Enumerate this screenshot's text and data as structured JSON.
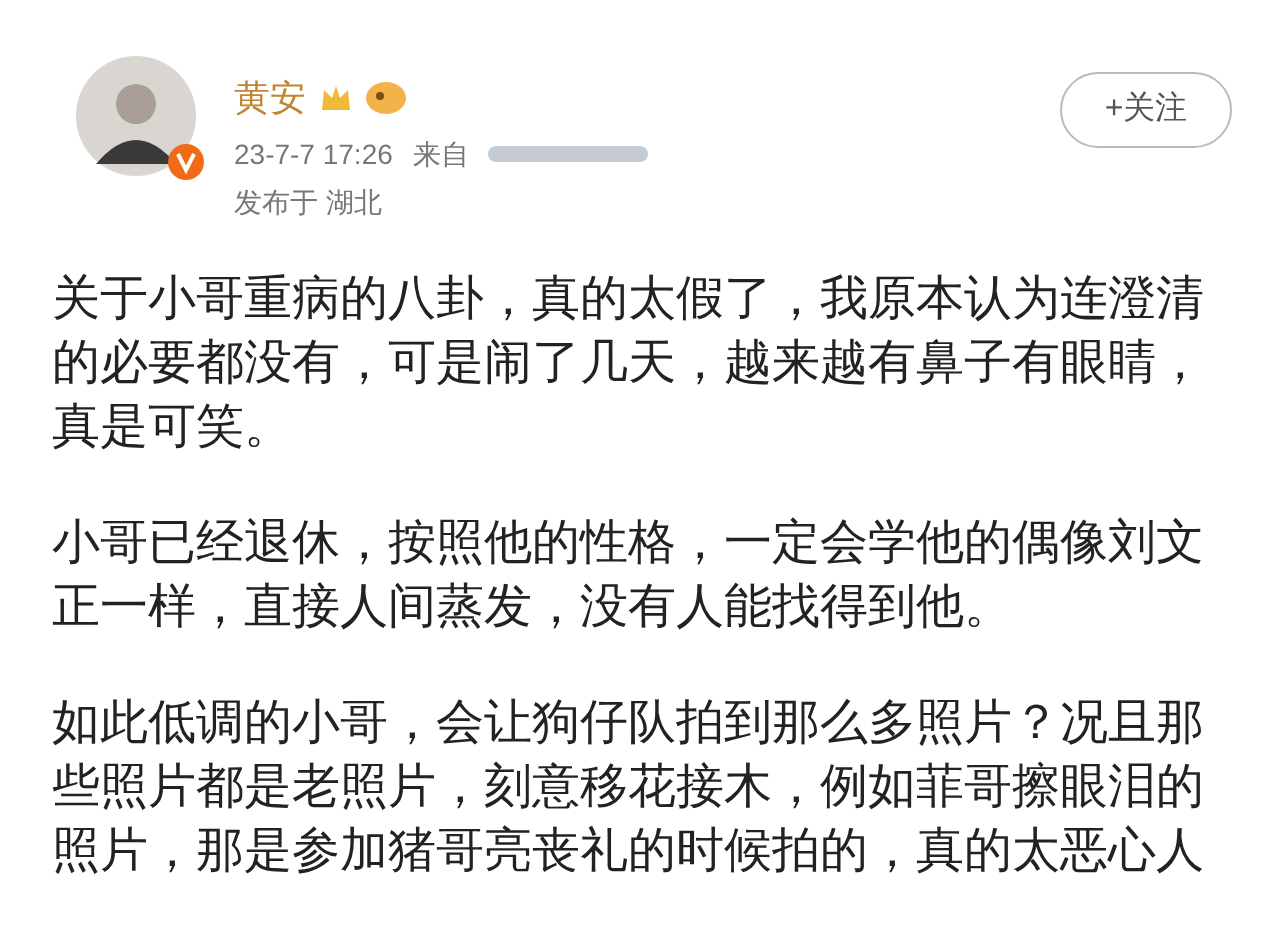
{
  "post": {
    "author": "黄安",
    "timestamp": "23-7-7 17:26",
    "source_label": "来自",
    "location": "发布于 湖北",
    "follow_button": "+关注",
    "paragraphs": [
      "关于小哥重病的八卦，真的太假了，我原本认为连澄清的必要都没有，可是闹了几天，越来越有鼻子有眼睛，真是可笑。",
      "小哥已经退休，按照他的性格，一定会学他的偶像刘文正一样，直接人间蒸发，没有人能找得到他。",
      "如此低调的小哥，会让狗仔队拍到那么多照片？况且那些照片都是老照片，刻意移花接木，例如菲哥擦眼泪的照片，那是参加猪哥亮丧礼的时候拍的，真的太恶心人"
    ]
  }
}
